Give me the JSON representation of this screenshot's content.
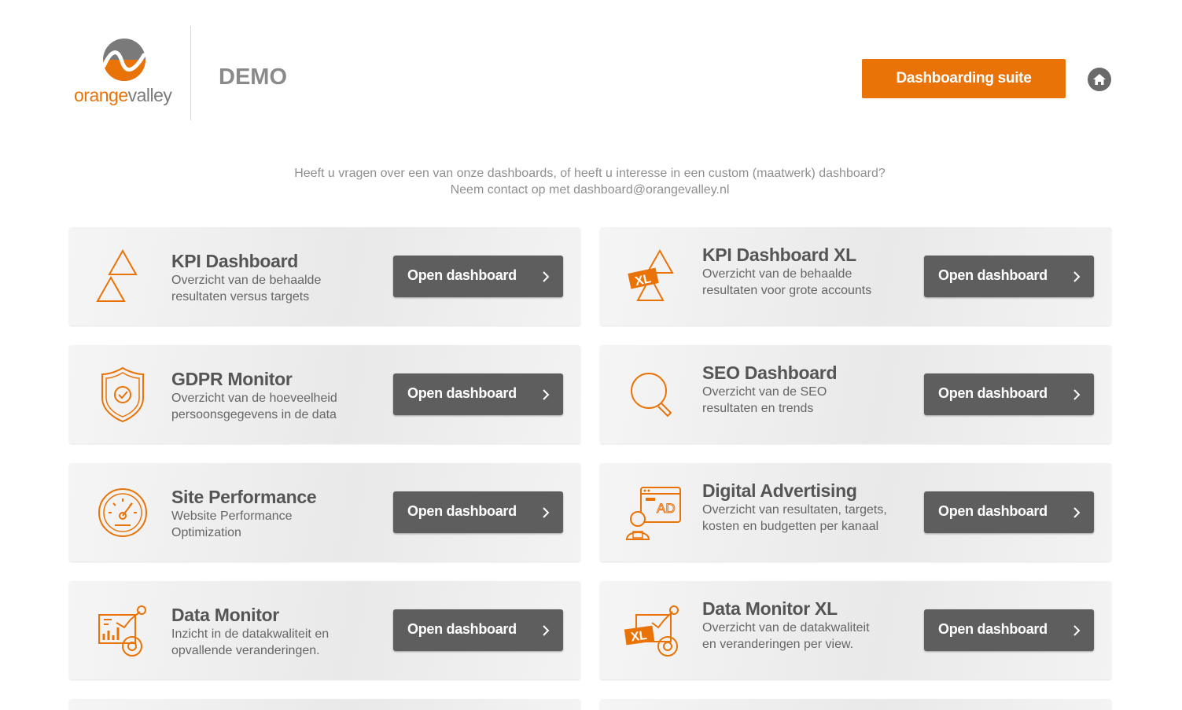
{
  "brand": {
    "logo_text_orange": "orange",
    "logo_text_gray": "valley",
    "accent_color": "#ea7308",
    "dark_button_color": "#5e5e5e"
  },
  "header": {
    "title": "DEMO",
    "suite_button": "Dashboarding suite",
    "home_icon": "home-icon"
  },
  "intro": {
    "line1": "Heeft u vragen over een van onze dashboards, of heeft u interesse in een custom (maatwerk) dashboard?",
    "line2": "Neem contact op met dashboard@orangevalley.nl"
  },
  "cards": [
    {
      "title": "KPI Dashboard",
      "desc1": "Overzicht van de behaalde",
      "desc2": "resultaten versus targets",
      "icon": "triangles-icon",
      "button": "Open dashboard"
    },
    {
      "title": "KPI Dashboard XL",
      "desc1": "Overzicht van de behaalde",
      "desc2": "resultaten voor grote accounts",
      "icon": "triangles-xl-icon",
      "icon_badge": "XL",
      "button": "Open dashboard"
    },
    {
      "title": "GDPR Monitor",
      "desc1": "Overzicht van de hoeveelheid",
      "desc2": "persoonsgegevens in de data",
      "icon": "shield-check-icon",
      "button": "Open dashboard"
    },
    {
      "title": "SEO Dashboard",
      "desc1": "Overzicht van de SEO",
      "desc2": "resultaten en trends",
      "icon": "magnifier-icon",
      "button": "Open dashboard"
    },
    {
      "title": "Site Performance",
      "desc1": "Website Performance",
      "desc2": "Optimization",
      "icon": "speedometer-icon",
      "button": "Open dashboard"
    },
    {
      "title": "Digital Advertising",
      "desc1": "Overzicht van resultaten, targets,",
      "desc2": "kosten en budgetten per kanaal",
      "icon": "ad-screen-icon",
      "icon_badge": "AD",
      "button": "Open dashboard"
    },
    {
      "title": "Data Monitor",
      "desc1": "Inzicht in de datakwaliteit en",
      "desc2": "opvallende veranderingen.",
      "icon": "chart-monitor-icon",
      "button": "Open dashboard"
    },
    {
      "title": "Data Monitor XL",
      "desc1": "Overzicht van de datakwaliteit",
      "desc2": "en veranderingen per view.",
      "icon": "chart-monitor-xl-icon",
      "icon_badge": "XL",
      "button": "Open dashboard"
    }
  ]
}
